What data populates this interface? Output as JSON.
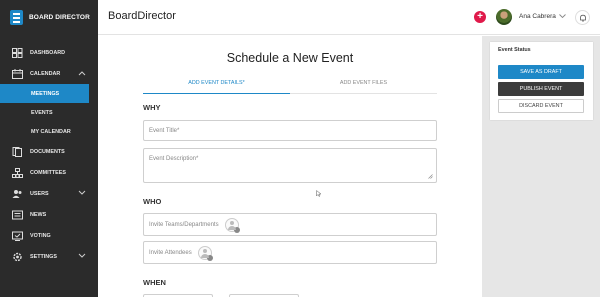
{
  "brand": {
    "name": "BOARD DIRECTOR"
  },
  "header": {
    "app_title": "BoardDirector",
    "user_name": "Ana Cabrera",
    "add_label": "+"
  },
  "sidebar": {
    "items": [
      {
        "label": "DASHBOARD",
        "icon": "dashboard-icon"
      },
      {
        "label": "CALENDAR",
        "icon": "calendar-icon",
        "expanded": true
      },
      {
        "label": "MEETINGS",
        "sub": true,
        "active": true
      },
      {
        "label": "EVENTS",
        "sub": true
      },
      {
        "label": "MY CALENDAR",
        "sub": true
      },
      {
        "label": "DOCUMENTS",
        "icon": "documents-icon"
      },
      {
        "label": "COMMITTEES",
        "icon": "committees-icon"
      },
      {
        "label": "USERS",
        "icon": "users-icon",
        "expandable": true
      },
      {
        "label": "NEWS",
        "icon": "news-icon"
      },
      {
        "label": "VOTING",
        "icon": "voting-icon"
      },
      {
        "label": "SETTINGS",
        "icon": "settings-icon",
        "expandable": true
      }
    ]
  },
  "main": {
    "page_title": "Schedule a New Event",
    "tabs": [
      {
        "label": "ADD EVENT DETAILS*",
        "active": true
      },
      {
        "label": "ADD EVENT FILES",
        "active": false
      }
    ],
    "sections": {
      "why": "WHY",
      "who": "WHO",
      "when": "WHEN"
    },
    "fields": {
      "event_title_placeholder": "Event Title*",
      "event_description_placeholder": "Event Description*",
      "invite_teams_placeholder": "Invite Teams/Departments",
      "invite_attendees_placeholder": "Invite Attendees"
    }
  },
  "status_panel": {
    "title": "Event Status",
    "save_draft": "SAVE AS DRAFT",
    "publish": "PUBLISH EVENT",
    "discard": "DISCARD EVENT"
  },
  "colors": {
    "accent": "#1e88c7",
    "sidebar_bg": "#2b2b2b",
    "add_button": "#e0194a",
    "publish_bg": "#3c3c3c"
  }
}
